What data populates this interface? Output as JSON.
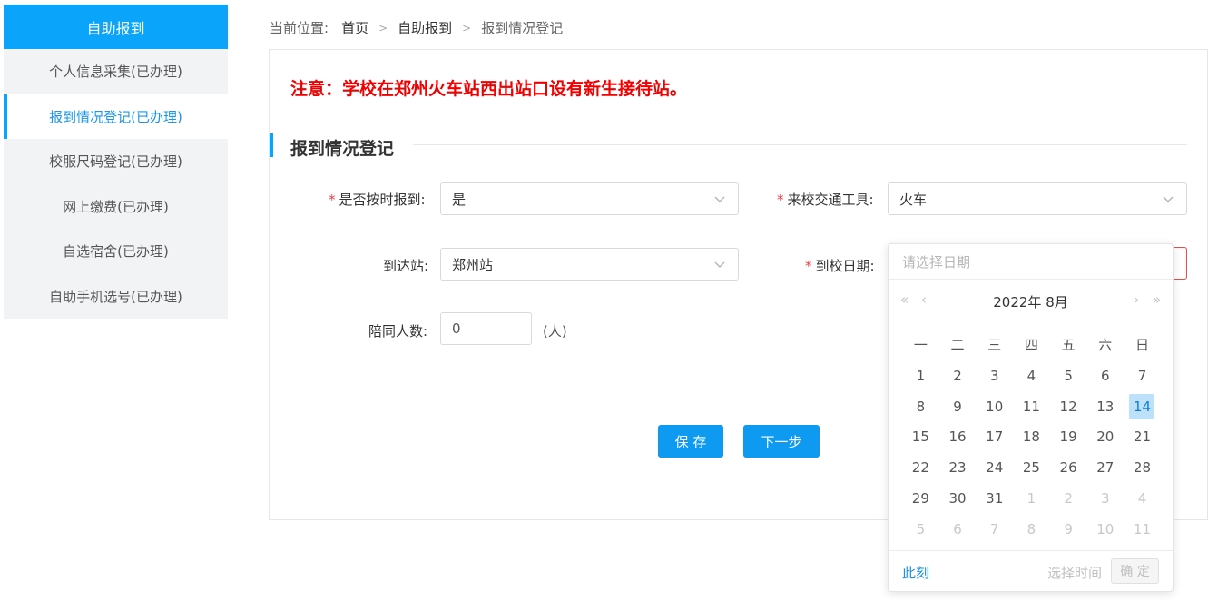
{
  "sidebar": {
    "header": "自助报到",
    "items": [
      {
        "label": "个人信息采集(已办理)"
      },
      {
        "label": "报到情况登记(已办理)"
      },
      {
        "label": "校服尺码登记(已办理)"
      },
      {
        "label": "网上缴费(已办理)"
      },
      {
        "label": "自选宿舍(已办理)"
      },
      {
        "label": "自助手机选号(已办理)"
      }
    ],
    "active_index": 1
  },
  "breadcrumb": {
    "prefix": "当前位置:",
    "items": [
      "首页",
      "自助报到",
      "报到情况登记"
    ],
    "separator": ">"
  },
  "notice": "注意：学校在郑州火车站西出站口设有新生接待站。",
  "section_title": "报到情况登记",
  "form": {
    "on_time": {
      "label": "是否按时报到:",
      "value": "是",
      "required": true
    },
    "transport": {
      "label": "来校交通工具:",
      "value": "火车",
      "required": true
    },
    "station": {
      "label": "到达站:",
      "value": "郑州站",
      "required": false
    },
    "arrival_date": {
      "label": "到校日期:",
      "placeholder": "请选择日期",
      "required": true
    },
    "companions": {
      "label": "陪同人数:",
      "value": "0",
      "unit": "(人)"
    }
  },
  "buttons": {
    "save": "保 存",
    "next": "下一步"
  },
  "datepicker": {
    "placeholder": "请选择日期",
    "title": "2022年 8月",
    "nav": {
      "prev_year": "«",
      "prev_month": "‹",
      "next_month": "›",
      "next_year": "»"
    },
    "weekdays": [
      "一",
      "二",
      "三",
      "四",
      "五",
      "六",
      "日"
    ],
    "days": [
      {
        "d": "1"
      },
      {
        "d": "2"
      },
      {
        "d": "3"
      },
      {
        "d": "4"
      },
      {
        "d": "5"
      },
      {
        "d": "6"
      },
      {
        "d": "7"
      },
      {
        "d": "8"
      },
      {
        "d": "9"
      },
      {
        "d": "10"
      },
      {
        "d": "11"
      },
      {
        "d": "12"
      },
      {
        "d": "13"
      },
      {
        "d": "14",
        "today": true
      },
      {
        "d": "15"
      },
      {
        "d": "16"
      },
      {
        "d": "17"
      },
      {
        "d": "18"
      },
      {
        "d": "19"
      },
      {
        "d": "20"
      },
      {
        "d": "21"
      },
      {
        "d": "22"
      },
      {
        "d": "23"
      },
      {
        "d": "24"
      },
      {
        "d": "25"
      },
      {
        "d": "26"
      },
      {
        "d": "27"
      },
      {
        "d": "28"
      },
      {
        "d": "29"
      },
      {
        "d": "30"
      },
      {
        "d": "31"
      },
      {
        "d": "1",
        "other": true
      },
      {
        "d": "2",
        "other": true
      },
      {
        "d": "3",
        "other": true
      },
      {
        "d": "4",
        "other": true
      },
      {
        "d": "5",
        "other": true
      },
      {
        "d": "6",
        "other": true
      },
      {
        "d": "7",
        "other": true
      },
      {
        "d": "8",
        "other": true
      },
      {
        "d": "9",
        "other": true
      },
      {
        "d": "10",
        "other": true
      },
      {
        "d": "11",
        "other": true
      }
    ],
    "now_label": "此刻",
    "select_time_label": "选择时间",
    "ok_label": "确 定"
  },
  "colors": {
    "accent": "#0aa5fa",
    "notice": "#f00000",
    "required": "#f04040"
  }
}
